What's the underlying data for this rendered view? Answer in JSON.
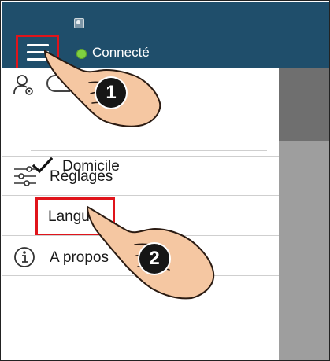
{
  "status_bar": {
    "app_icon": "app-icon"
  },
  "header": {
    "menu_icon": "hamburger-icon",
    "connection_status": "Connecté",
    "status_color": "#7fd040",
    "bar_color": "#1f4e6b"
  },
  "drawer": {
    "account_icon": "user-settings-icon",
    "home_check_icon": "check-icon",
    "home": "Domicile",
    "settings_icon": "sliders-icon",
    "settings": "Réglages",
    "language": "Langue",
    "about_icon": "info-icon",
    "about": "A propos"
  },
  "annotations": {
    "step_1": "1",
    "step_2": "2",
    "highlight_color": "#e0141b"
  }
}
